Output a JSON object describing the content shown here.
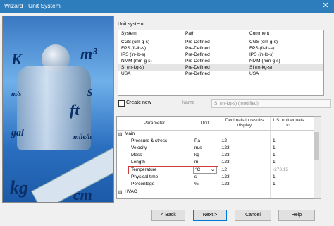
{
  "window": {
    "title": "Wizard - Unit System",
    "close_glyph": "✕"
  },
  "splash": {
    "labels": [
      "K",
      "m³",
      "m/s",
      "s",
      "ft",
      "gal",
      "mile/h",
      "kg",
      "cm"
    ]
  },
  "unit_system": {
    "label": "Unit system:",
    "columns": [
      "System",
      "Path",
      "Comment"
    ],
    "rows": [
      {
        "system": "CGS (cm-g-s)",
        "path": "Pre-Defined",
        "comment": "CGS (cm-g-s)"
      },
      {
        "system": "FPS (ft-lb-s)",
        "path": "Pre-Defined",
        "comment": "FPS (ft-lb-s)"
      },
      {
        "system": "IPS (in-lb-s)",
        "path": "Pre-Defined",
        "comment": "IPS (in-lb-s)"
      },
      {
        "system": "NMM (mm-g-s)",
        "path": "Pre-Defined",
        "comment": "NMM (mm-g-s)"
      },
      {
        "system": "SI (m-kg-s)",
        "path": "Pre-Defined",
        "comment": "SI (m-kg-s)"
      },
      {
        "system": "USA",
        "path": "Pre-Defined",
        "comment": "USA"
      }
    ]
  },
  "create_new": {
    "label": "Create new",
    "checked": false,
    "name_label": "Name",
    "name_value": "SI (m-kg-s) (modified)"
  },
  "parameters": {
    "headers": [
      "Parameter",
      "Unit",
      "Decimals in results display",
      "1 SI unit equals to"
    ],
    "group_main": "Main",
    "group_main_toggle": "⊟",
    "rows": [
      {
        "name": "Pressure & stress",
        "unit": "Pa",
        "decimals": ".12",
        "si": "1"
      },
      {
        "name": "Velocity",
        "unit": "m/s",
        "decimals": ".123",
        "si": "1"
      },
      {
        "name": "Mass",
        "unit": "kg",
        "decimals": ".123",
        "si": "1"
      },
      {
        "name": "Length",
        "unit": "m",
        "decimals": ".123",
        "si": "1"
      },
      {
        "name": "Temperature",
        "unit": "°C",
        "decimals": ".12",
        "si": "-273.15"
      },
      {
        "name": "Physical time",
        "unit": "s",
        "decimals": ".123",
        "si": "1"
      },
      {
        "name": "Percentage",
        "unit": "%",
        "decimals": ".123",
        "si": "1"
      }
    ],
    "group_hvac": "HVAC",
    "group_hvac_toggle": "⊞",
    "highlight_color": "#d23a3a"
  },
  "buttons": {
    "back": "< Back",
    "next": "Next >",
    "cancel": "Cancel",
    "help": "Help"
  }
}
